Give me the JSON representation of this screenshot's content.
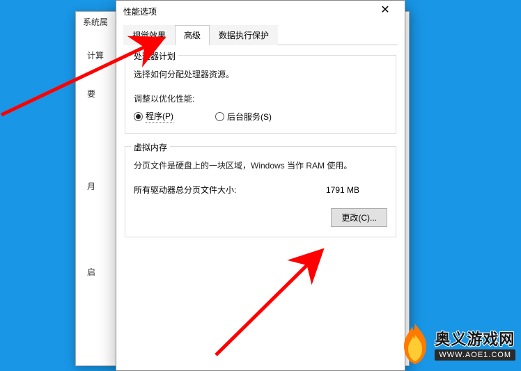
{
  "bg": {
    "title": "系统属",
    "side": {
      "item1": "计算",
      "item2": "要",
      "item3": "",
      "item4": "月",
      "item5": "启"
    }
  },
  "dialog": {
    "title": "性能选项",
    "tabs": {
      "visual": "视觉效果",
      "advanced": "高级",
      "dep": "数据执行保护"
    },
    "proc": {
      "legend": "处理器计划",
      "desc": "选择如何分配处理器资源。",
      "adjust_label": "调整以优化性能:",
      "opt_programs": "程序(P)",
      "opt_background": "后台服务(S)"
    },
    "vm": {
      "legend": "虚拟内存",
      "desc": "分页文件是硬盘上的一块区域，Windows 当作 RAM 使用。",
      "total_label": "所有驱动器总分页文件大小:",
      "total_value": "1791 MB",
      "change_btn": "更改(C)..."
    }
  },
  "watermark": {
    "name": "奥义游戏网",
    "url": "WWW.AOE1.COM"
  }
}
